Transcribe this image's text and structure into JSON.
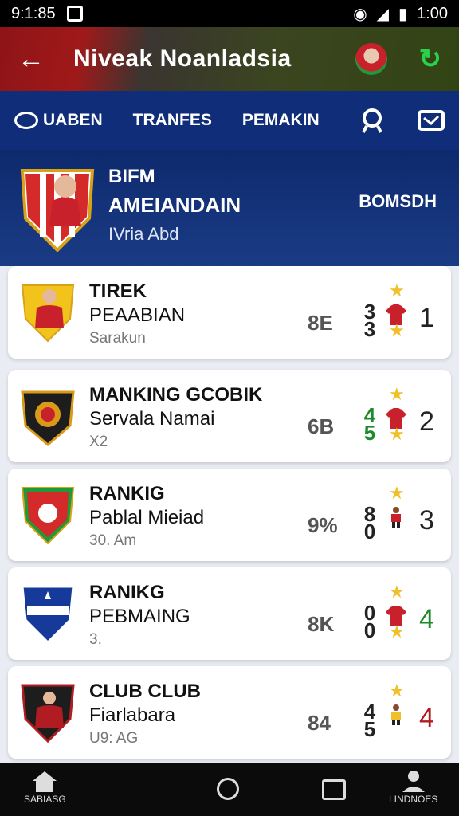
{
  "status_bar": {
    "time_left": "9:1:85",
    "time_right": "1:00"
  },
  "app_bar": {
    "title": "Niveak Noanladsia",
    "back_icon": "arrow-left-icon",
    "refresh_icon": "refresh-icon"
  },
  "tabs": [
    {
      "label": "UABEN"
    },
    {
      "label": "TRANFES"
    },
    {
      "label": "PEMAKIN"
    }
  ],
  "hero": {
    "line1": "BIFM",
    "line2": "AMEIANDAIN",
    "line3": "IVria Abd",
    "right": "BOMSDH"
  },
  "cards": [
    {
      "title": "TIREK",
      "subtitle": "PEAABIAN",
      "meta": "Sarakun",
      "stat": "8E",
      "num_a": "3\n3",
      "num_b": "1",
      "colors": {
        "crest": "#f2c31a",
        "accent": "#c8212b"
      }
    },
    {
      "title": "MANKING GCOBIK",
      "subtitle": "Servala Namai",
      "meta": "X2",
      "stat": "6B",
      "num_a": "4\n5",
      "num_b": "2",
      "colors": {
        "crest": "#d99a1a",
        "accent": "#c8212b"
      }
    },
    {
      "title": "RANKIG",
      "subtitle": "Pablal Mieiad",
      "meta": "30. Am",
      "stat": "9%",
      "num_a": "8\n0",
      "num_b": "3",
      "colors": {
        "crest": "#1f9a3a",
        "accent": "#c8212b"
      }
    },
    {
      "title": "RANIKG",
      "subtitle": "PEBMAING",
      "meta": "3.",
      "stat": "8K",
      "num_a": "0\n0",
      "num_b": "4",
      "colors": {
        "crest": "#153a9a",
        "accent": "#c8212b"
      }
    },
    {
      "title": "CLUB CLUB",
      "subtitle": "Fiarlabara",
      "meta": "U9: AG",
      "stat": "84",
      "num_a": "4\n5",
      "num_b": "4",
      "colors": {
        "crest": "#b01c22",
        "accent": "#c8212b"
      }
    }
  ],
  "bottom_nav": {
    "left_label": "SABIASG",
    "right_label": "LINDNOES"
  }
}
